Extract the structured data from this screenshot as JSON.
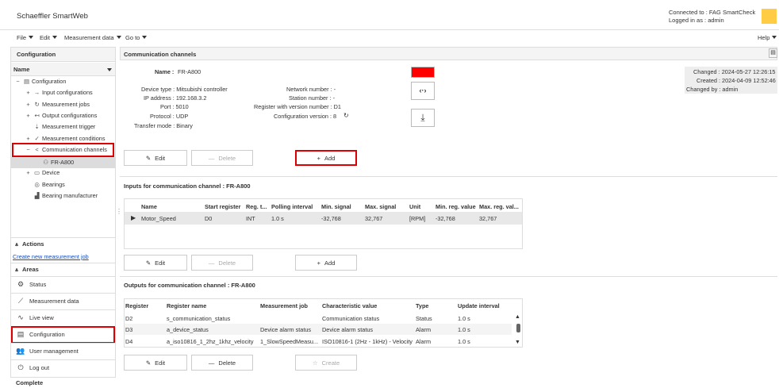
{
  "header": {
    "app_title": "Schaeffler SmartWeb",
    "connected_to": "Connected to : FAG SmartCheck",
    "logged_in_as": "Logged in as : admin",
    "logo_color": "#ffcc44"
  },
  "menu": {
    "file": "File",
    "edit": "Edit",
    "measurement_data": "Measurement data",
    "go_to": "Go to",
    "help": "Help"
  },
  "sidebar": {
    "header": "Configuration",
    "name_label": "Name",
    "tree": {
      "configuration": "Configuration",
      "input_configurations": "Input configurations",
      "measurement_jobs": "Measurement jobs",
      "output_configurations": "Output configurations",
      "measurement_trigger": "Measurement trigger",
      "measurement_conditions": "Measurement conditions",
      "communication_channels": "Communication channels",
      "fr_a800": "FR-A800",
      "device": "Device",
      "bearings": "Bearings",
      "bearing_manufacturer": "Bearing manufacturer"
    },
    "actions_label": "Actions",
    "create_link": "Create new measurement job",
    "areas_label": "Areas",
    "areas": {
      "status": "Status",
      "measurement_data": "Measurement data",
      "live_view": "Live view",
      "configuration": "Configuration",
      "user_management": "User management",
      "log_out": "Log out"
    }
  },
  "channel": {
    "section_title": "Communication channels",
    "name_label": "Name :",
    "name_value": "FR-A800",
    "device_type": "Device type : Mitsubishi controller",
    "ip_address": "IP address : 192.168.3.2",
    "port": "Port : 5010",
    "protocol": "Protocol : UDP",
    "transfer_mode": "Transfer mode : Binary",
    "network_number": "Network number : -",
    "station_number": "Station number : -",
    "register_version": "Register with version number : D1",
    "config_version": "Configuration version : 8",
    "changed": "Changed : 2024-05-27 12:26:15",
    "created": "Created : 2024-04-09 12:52:46",
    "changed_by": "Changed by : admin",
    "status_color": "#ff0000",
    "edit": "Edit",
    "delete": "Delete",
    "add": "Add"
  },
  "inputs": {
    "title": "Inputs for communication channel : FR-A800",
    "columns": [
      "Name",
      "Start register",
      "Reg. t...",
      "Polling interval",
      "Min. signal",
      "Max. signal",
      "Unit",
      "Min. reg. value",
      "Max. reg. val..."
    ],
    "rows": [
      [
        "Motor_Speed",
        "D0",
        "INT",
        "1.0 s",
        "-32,768",
        "32,767",
        "[RPM]",
        "-32,768",
        "32,767"
      ]
    ],
    "edit": "Edit",
    "delete": "Delete",
    "add": "Add"
  },
  "outputs": {
    "title": "Outputs for communication channel : FR-A800",
    "columns": [
      "Register",
      "Register name",
      "Measurement job",
      "Characteristic value",
      "Type",
      "Update interval"
    ],
    "rows": [
      [
        "D2",
        "s_communication_status",
        "",
        "Communication status",
        "Status",
        "1.0 s"
      ],
      [
        "D3",
        "a_device_status",
        "Device alarm status",
        "Device alarm status",
        "Alarm",
        "1.0 s"
      ],
      [
        "D4",
        "a_iso10816_1_2hz_1khz_velocity",
        "1_SlowSpeedMeasu...",
        "ISO10816-1 (2Hz - 1kHz) - Velocity",
        "Alarm",
        "1.0 s"
      ]
    ],
    "edit": "Edit",
    "delete": "Delete",
    "create": "Create"
  },
  "status_bar": "Complete"
}
